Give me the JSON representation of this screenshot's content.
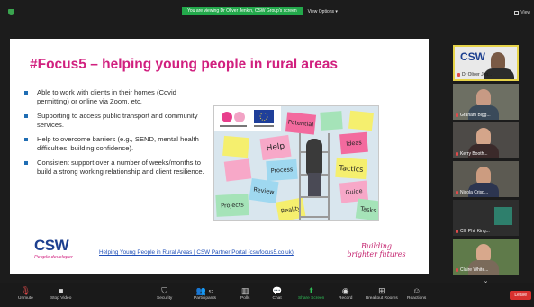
{
  "banner": {
    "viewing_text": "You are viewing Dr Oliver Jenkin, CSW Group's screen",
    "view_options": "View Options ▾",
    "view_label": "View"
  },
  "slide": {
    "title": "#Focus5 – helping young people in rural areas",
    "bullets": [
      "Able to work with clients in their homes (Covid permitting) or online via Zoom, etc.",
      "Supporting to access public transport and community services.",
      "Help to overcome barriers (e.g., SEND, mental health difficulties, building confidence).",
      "Consistent support over a number of weeks/months to build a strong working relationship and client resilience."
    ],
    "sticky_notes": [
      "Help",
      "Potential",
      "Process",
      "Tactics",
      "Review",
      "Guide",
      "Projects",
      "Reality",
      "Ideas",
      "Tasks"
    ],
    "logo_text": "CSW",
    "logo_sub": "People developer",
    "footer_link": "Helping Young People in Rural Areas | CSW Partner Portal (cswfocus5.co.uk)",
    "tagline": "Building brighter futures",
    "accent_color": "#d1207f"
  },
  "participants": [
    {
      "name": "Dr Oliver Jen...",
      "active": true
    },
    {
      "name": "Graham Bigg..."
    },
    {
      "name": "Kerry Booth..."
    },
    {
      "name": "Nicola Crisp..."
    },
    {
      "name": "Cllr Phil King..."
    },
    {
      "name": "Claire White..."
    }
  ],
  "toolbar": {
    "unmute": "Unmute",
    "stop_video": "Stop Video",
    "security": "Security",
    "participants": "Participants",
    "participants_count": "52",
    "polls": "Polls",
    "chat": "Chat",
    "share_screen": "Share Screen",
    "record": "Record",
    "breakout": "Breakout Rooms",
    "reactions": "Reactions",
    "leave": "Leave"
  }
}
